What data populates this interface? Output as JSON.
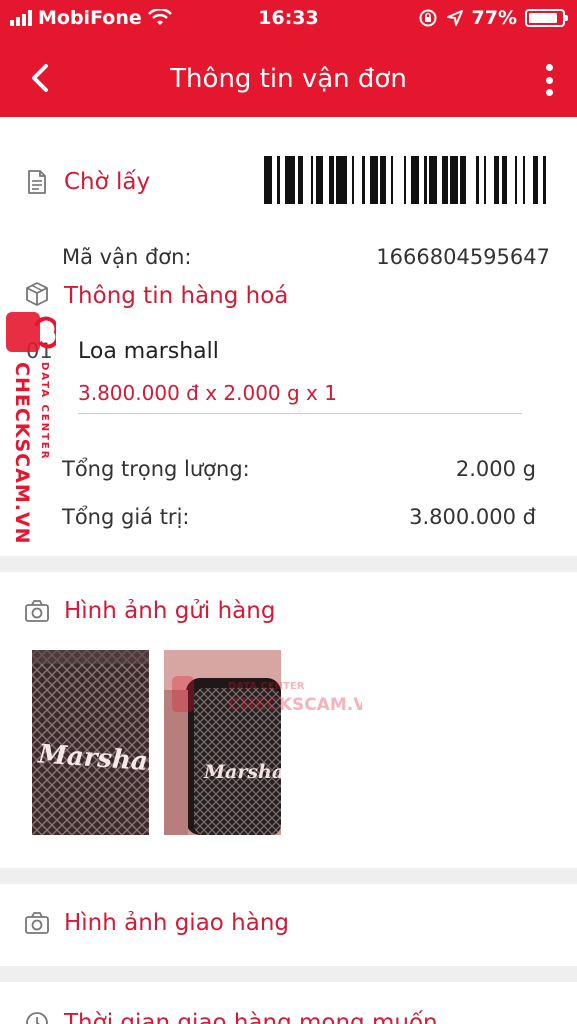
{
  "status_bar": {
    "carrier": "MobiFone",
    "time": "16:33",
    "battery": "77%"
  },
  "header": {
    "title": "Thông tin vận đơn"
  },
  "shipment": {
    "status": "Chờ lấy",
    "code_label": "Mã vận đơn:",
    "code_value": "1666804595647"
  },
  "goods": {
    "title": "Thông tin hàng hoá",
    "item_index": "01",
    "item_name": "Loa marshall",
    "item_detail": "3.800.000 đ x 2.000 g x 1",
    "total_weight_label": "Tổng trọng lượng:",
    "total_weight_value": "2.000 g",
    "total_value_label": "Tổng giá trị:",
    "total_value_value": "3.800.000 đ"
  },
  "send_images": {
    "title": "Hình ảnh gửi hàng",
    "photos": [
      {
        "brand_text": "Marshall"
      },
      {
        "brand_text": "Marshall"
      }
    ]
  },
  "delivery_images": {
    "title": "Hình ảnh giao hàng"
  },
  "preferred_time": {
    "title": "Thời gian giao hàng mong muốn"
  },
  "watermark": {
    "brand": "CHECKSCAM.VN",
    "tagline": "DATA CENTER"
  },
  "colors": {
    "primary": "#e5172f",
    "accent_text": "#d31a36"
  },
  "icons": [
    "back-arrow-icon",
    "more-vertical-icon",
    "document-icon",
    "box-icon",
    "camera-icon",
    "clock-icon",
    "wifi-icon",
    "signal-icon",
    "location-arrow-icon",
    "rotation-lock-icon",
    "battery-icon"
  ]
}
